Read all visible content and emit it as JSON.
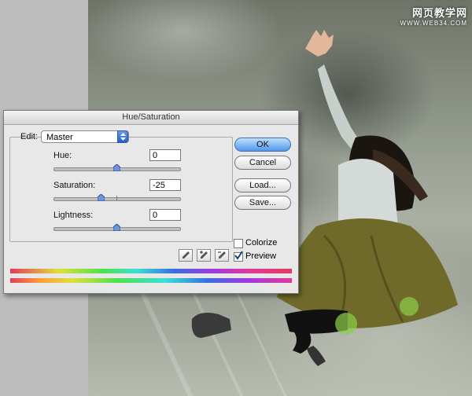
{
  "watermark": {
    "title": "网页教学网",
    "url": "WWW.WEB34.COM"
  },
  "dialog": {
    "title": "Hue/Saturation",
    "edit_label": "Edit:",
    "edit_value": "Master",
    "hue": {
      "label": "Hue:",
      "value": "0"
    },
    "saturation": {
      "label": "Saturation:",
      "value": "-25"
    },
    "lightness": {
      "label": "Lightness:",
      "value": "0"
    },
    "buttons": {
      "ok": "OK",
      "cancel": "Cancel",
      "load": "Load...",
      "save": "Save..."
    },
    "colorize": {
      "label": "Colorize",
      "checked": false
    },
    "preview": {
      "label": "Preview",
      "checked": true
    }
  }
}
